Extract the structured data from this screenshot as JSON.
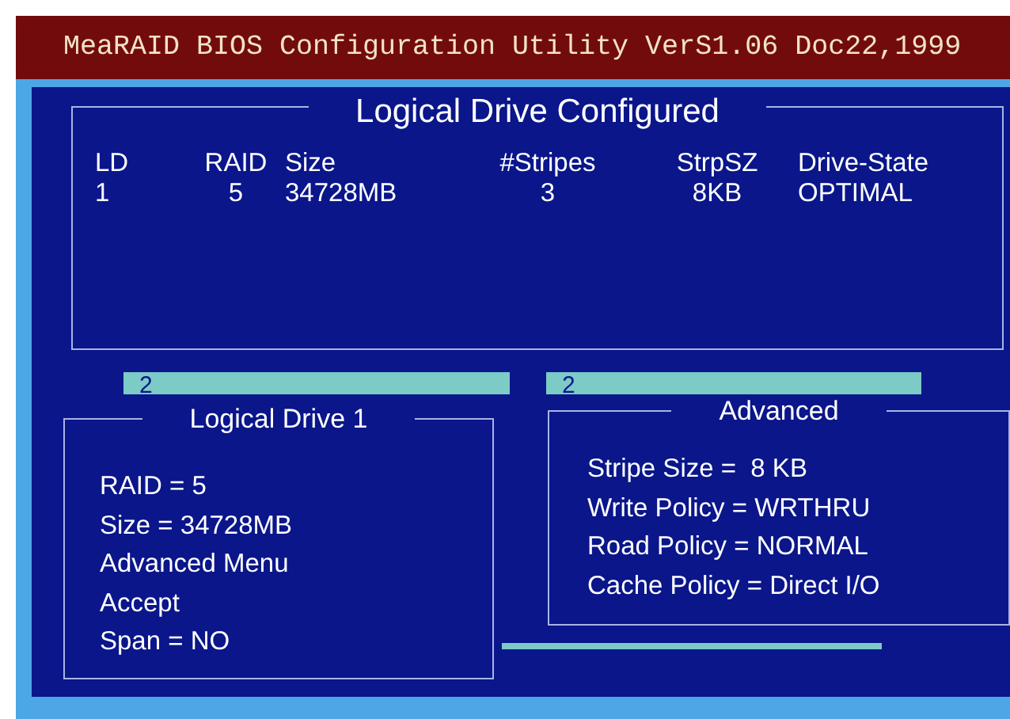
{
  "window": {
    "title": "MeaRAID BIOS Configuration Utility VerS1.06 Doc22,1999"
  },
  "configured": {
    "title": "Logical Drive Configured",
    "columns": [
      "LD",
      "RAID",
      "Size",
      "#Stripes",
      "StrpSZ",
      "Drive-State"
    ],
    "rows": [
      [
        "1",
        "5",
        "34728MB",
        "3",
        "8KB",
        "OPTIMAL"
      ]
    ]
  },
  "tabs": [
    {
      "label": "2"
    },
    {
      "label": "2"
    }
  ],
  "logical_drive": {
    "title": "Logical Drive 1",
    "items": [
      "RAID = 5",
      "Size = 34728MB",
      "Advanced Menu",
      "Accept",
      "Span = NO"
    ]
  },
  "advanced": {
    "title": "Advanced",
    "items": [
      "Stripe Size =  8 KB",
      "Write Policy = WRTHRU",
      "Road Policy = NORMAL",
      "Cache Policy = Direct I/O"
    ]
  }
}
